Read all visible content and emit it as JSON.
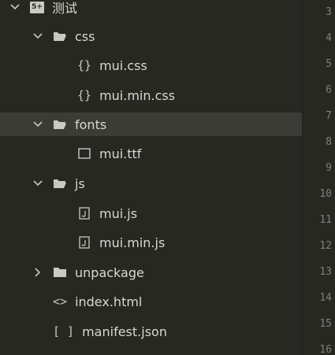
{
  "project": {
    "badge": "5+",
    "name": "测试"
  },
  "tree": {
    "css_folder": "css",
    "css_files": [
      "mui.css",
      "mui.min.css"
    ],
    "fonts_folder": "fonts",
    "fonts_files": [
      "mui.ttf"
    ],
    "js_folder": "js",
    "js_files": [
      "mui.js",
      "mui.min.js"
    ],
    "unpackage_folder": "unpackage",
    "index_file": "index.html",
    "manifest_file": "manifest.json",
    "css_file_glyph": "{}",
    "html_file_glyph": "<>",
    "json_file_glyph": "[ ]"
  },
  "gutter": {
    "line_numbers": [
      "3",
      "4",
      "5",
      "6",
      "7",
      "8",
      "9",
      "10",
      "11",
      "12",
      "13",
      "14",
      "15",
      "16"
    ]
  },
  "colors": {
    "background": "#272822",
    "selected_row": "#3b3c36",
    "text": "#d7d8d2",
    "line_number": "#7f8078"
  }
}
